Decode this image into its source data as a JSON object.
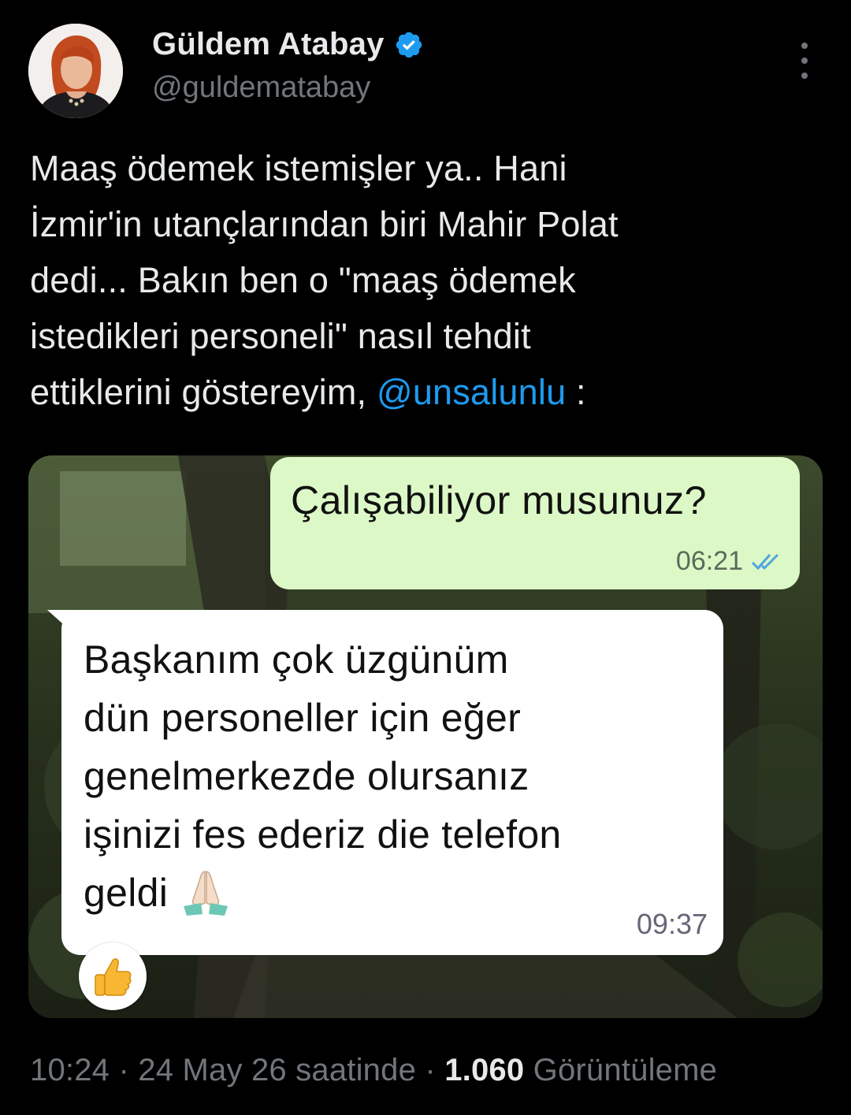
{
  "author": {
    "display_name": "Güldem Atabay",
    "handle": "@guldematabay",
    "verified_icon": "verified-badge-icon",
    "verified_color": "#1d9bf0"
  },
  "tweet": {
    "text_before_mention": "Maaş ödemek istemişler ya.. Hani\nİzmir'in utançlarından biri Mahir Polat\ndedi... Bakın ben o \"maaş ödemek\nistedikleri personeli\" nasıl tehdit\nettiklerini göstereyim, ",
    "mention": "@unsalunlu",
    "text_after_mention": " :",
    "mention_color": "#1d9bf0"
  },
  "media": {
    "outgoing_message": {
      "text": "Çalışabiliyor musunuz?",
      "time": "06:21",
      "status_icon": "double-check-icon",
      "bubble_color": "#dcf8c6"
    },
    "incoming_message": {
      "text": "Başkanım çok üzgünüm\ndün personeller için eğer\ngenelmerkezde olursanız\nişinizi fes ederiz die telefon\ngeldi",
      "emoji_icon": "folded-hands-emoji-icon",
      "time": "09:37",
      "bubble_color": "#ffffff"
    },
    "reaction_icon": "thumbs-up-emoji-icon"
  },
  "footer": {
    "time": "10:24",
    "separator": "·",
    "date": "24 May 26 saatinde",
    "views_count": "1.060",
    "views_label": "Görüntüleme"
  }
}
